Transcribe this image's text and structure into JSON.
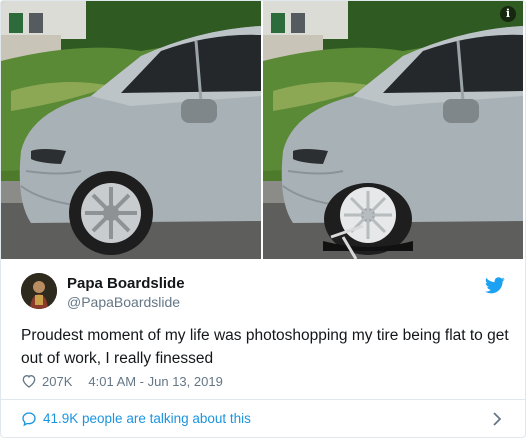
{
  "media": {
    "left_photo": {
      "icon": "car-photo"
    },
    "right_photo": {
      "icon": "car-photo-flat-tire"
    },
    "info_icon": "i"
  },
  "tweet": {
    "display_name": "Papa Boardslide",
    "handle": "@PapaBoardslide",
    "text": "Proudest moment of my life was photoshopping my tire being flat to get out of work, I really finessed",
    "likes": "207K",
    "timestamp": "4:01 AM - Jun 13, 2019",
    "conversation_text": "41.9K people are talking about this"
  },
  "colors": {
    "accent": "#1da1f2",
    "link": "#1b95e0",
    "secondary_text": "#657786",
    "border": "#e1e8ed"
  }
}
